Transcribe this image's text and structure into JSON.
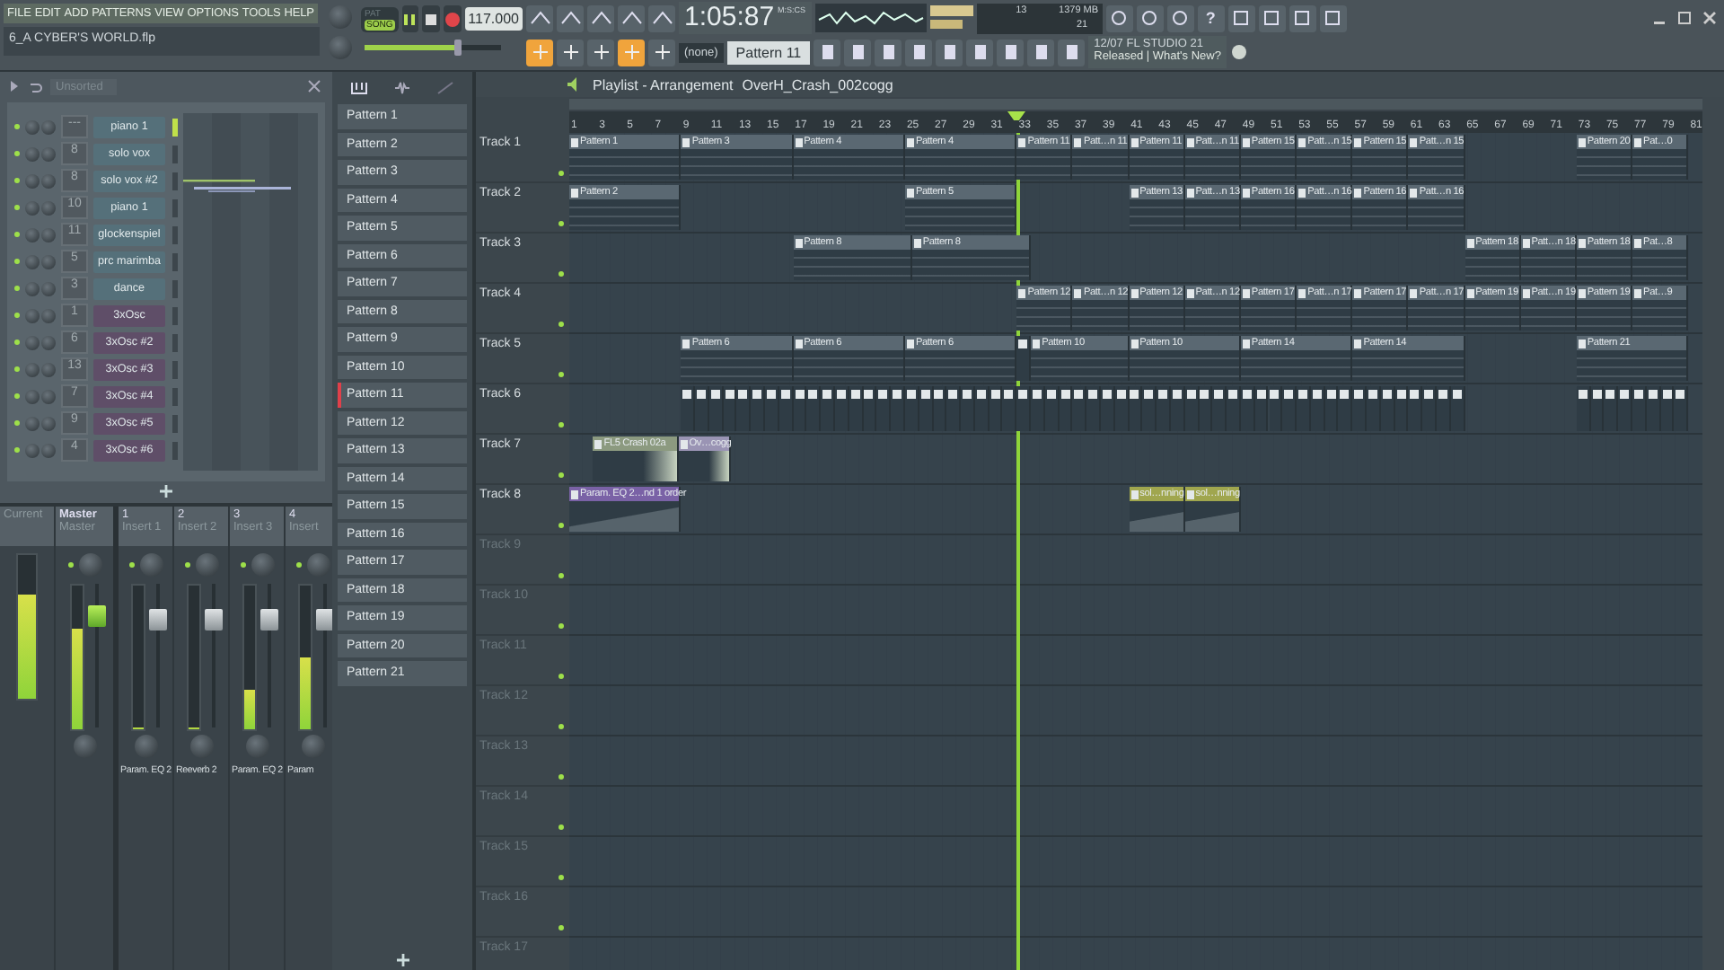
{
  "menu": [
    "FILE",
    "EDIT",
    "ADD",
    "PATTERNS",
    "VIEW",
    "OPTIONS",
    "TOOLS",
    "HELP"
  ],
  "project_file": "6_A CYBER'S WORLD.flp",
  "transport": {
    "modes": [
      {
        "label": "PAT",
        "selected": false
      },
      {
        "label": "SONG",
        "selected": true
      }
    ],
    "tempo": "117.000",
    "time": "1:05:87",
    "time_unit": "M:S:CS"
  },
  "master_pitch": {
    "level": 0.68
  },
  "toolbar_toggles": [
    {
      "on": true
    },
    {
      "on": false
    },
    {
      "on": false
    },
    {
      "on": true
    },
    {
      "on": false
    }
  ],
  "snap": "(none)",
  "current_pattern": "Pattern 11",
  "resources": {
    "cpu": "13",
    "memory": "1379 MB",
    "polyphony": "21"
  },
  "help_label": "?",
  "news": {
    "date": "12/07",
    "title": "FL STUDIO 21",
    "link": "Released | What's New?"
  },
  "channel_rack": {
    "filter": "Unsorted",
    "channels": [
      {
        "name": "piano 1",
        "mixer": "---",
        "kind": "instrument",
        "selected": true
      },
      {
        "name": "solo vox",
        "mixer": "8",
        "kind": "instrument",
        "selected": false
      },
      {
        "name": "solo vox #2",
        "mixer": "8",
        "kind": "instrument",
        "selected": false
      },
      {
        "name": "piano 1",
        "mixer": "10",
        "kind": "instrument",
        "selected": false
      },
      {
        "name": "glockenspiel",
        "mixer": "11",
        "kind": "instrument",
        "selected": false
      },
      {
        "name": "prc marimba",
        "mixer": "5",
        "kind": "instrument",
        "selected": false
      },
      {
        "name": "dance",
        "mixer": "3",
        "kind": "instrument",
        "selected": false
      },
      {
        "name": "3xOsc",
        "mixer": "1",
        "kind": "synth",
        "selected": false
      },
      {
        "name": "3xOsc #2",
        "mixer": "6",
        "kind": "synth",
        "selected": false
      },
      {
        "name": "3xOsc #3",
        "mixer": "13",
        "kind": "synth",
        "selected": false
      },
      {
        "name": "3xOsc #4",
        "mixer": "7",
        "kind": "synth",
        "selected": false
      },
      {
        "name": "3xOsc #5",
        "mixer": "9",
        "kind": "synth",
        "selected": false
      },
      {
        "name": "3xOsc #6",
        "mixer": "4",
        "kind": "synth",
        "selected": false
      }
    ]
  },
  "mixer": {
    "strips": [
      {
        "kind": "current",
        "name": "Current",
        "meter": {
          "level": 0.72
        }
      },
      {
        "kind": "master",
        "number": "Master",
        "name": "Master",
        "meter": {
          "level": 0.7
        },
        "fader": {
          "level": 0.78
        }
      },
      {
        "kind": "insert",
        "number": "1",
        "name": "Insert 1",
        "meter": {
          "level": 0
        },
        "fader": {
          "level": 0.75
        },
        "plugin": "Param. EQ 2"
      },
      {
        "kind": "insert",
        "number": "2",
        "name": "Insert 2",
        "meter": {
          "level": 0
        },
        "fader": {
          "level": 0.75
        },
        "plugin": "Reeverb 2"
      },
      {
        "kind": "insert",
        "number": "3",
        "name": "Insert 3",
        "meter": {
          "level": 0.28
        },
        "fader": {
          "level": 0.75
        },
        "plugin": "Param. EQ 2"
      },
      {
        "kind": "insert",
        "number": "4",
        "name": "Insert",
        "meter": {
          "level": 0.5
        },
        "fader": {
          "level": 0.75
        },
        "plugin": "Param"
      }
    ]
  },
  "patterns": [
    {
      "name": "Pattern 1",
      "selected": false
    },
    {
      "name": "Pattern 2",
      "selected": false
    },
    {
      "name": "Pattern 3",
      "selected": false
    },
    {
      "name": "Pattern 4",
      "selected": false
    },
    {
      "name": "Pattern 5",
      "selected": false
    },
    {
      "name": "Pattern 6",
      "selected": false
    },
    {
      "name": "Pattern 7",
      "selected": false
    },
    {
      "name": "Pattern 8",
      "selected": false
    },
    {
      "name": "Pattern 9",
      "selected": false
    },
    {
      "name": "Pattern 10",
      "selected": false
    },
    {
      "name": "Pattern 11",
      "selected": true
    },
    {
      "name": "Pattern 12",
      "selected": false
    },
    {
      "name": "Pattern 13",
      "selected": false
    },
    {
      "name": "Pattern 14",
      "selected": false
    },
    {
      "name": "Pattern 15",
      "selected": false
    },
    {
      "name": "Pattern 16",
      "selected": false
    },
    {
      "name": "Pattern 17",
      "selected": false
    },
    {
      "name": "Pattern 18",
      "selected": false
    },
    {
      "name": "Pattern 19",
      "selected": false
    },
    {
      "name": "Pattern 20",
      "selected": false
    },
    {
      "name": "Pattern 21",
      "selected": false
    }
  ],
  "playlist": {
    "title": "Playlist - Arrangement",
    "breadcrumb": "OverH_Crash_002cogg",
    "ruler": [
      "1",
      "3",
      "5",
      "7",
      "9",
      "11",
      "13",
      "15",
      "17",
      "19",
      "21",
      "23",
      "25",
      "27",
      "29",
      "31",
      "33",
      "35",
      "37",
      "39",
      "41",
      "43",
      "45",
      "47",
      "49",
      "51",
      "53",
      "55",
      "57",
      "59",
      "61",
      "63",
      "65",
      "67",
      "69",
      "71",
      "73",
      "75",
      "77",
      "79",
      "81"
    ],
    "playhead": {
      "level": 0.395
    },
    "tracks": [
      {
        "name": "Track 1",
        "clips": [
          {
            "kind": "pattern",
            "label": "Pattern 1"
          },
          {
            "kind": "pattern",
            "label": "Pattern 3"
          },
          {
            "kind": "pattern",
            "label": "Pattern 4"
          },
          {
            "kind": "pattern",
            "label": "Pattern 4"
          },
          {
            "kind": "pattern",
            "label": "Pattern 11"
          },
          {
            "kind": "pattern",
            "label": "Patt…n 11"
          },
          {
            "kind": "pattern",
            "label": "Pattern 11"
          },
          {
            "kind": "pattern",
            "label": "Patt…n 11"
          },
          {
            "kind": "pattern",
            "label": "Pattern 15"
          },
          {
            "kind": "pattern",
            "label": "Patt…n 15"
          },
          {
            "kind": "pattern",
            "label": "Pattern 15"
          },
          {
            "kind": "pattern",
            "label": "Patt…n 15"
          },
          {
            "kind": "pattern",
            "label": "Pattern 20"
          },
          {
            "kind": "pattern",
            "label": "Pat…0"
          }
        ]
      },
      {
        "name": "Track 2",
        "clips": [
          {
            "kind": "pattern",
            "label": "Pattern 2"
          },
          {
            "kind": "pattern",
            "label": "Pattern 5"
          },
          {
            "kind": "pattern",
            "label": "Pattern 13"
          },
          {
            "kind": "pattern",
            "label": "Patt…n 13"
          },
          {
            "kind": "pattern",
            "label": "Pattern 16"
          },
          {
            "kind": "pattern",
            "label": "Patt…n 16"
          },
          {
            "kind": "pattern",
            "label": "Pattern 16"
          },
          {
            "kind": "pattern",
            "label": "Patt…n 16"
          }
        ]
      },
      {
        "name": "Track 3",
        "clips": [
          {
            "kind": "pattern",
            "label": "Pattern 8"
          },
          {
            "kind": "pattern",
            "label": "Pattern 8"
          },
          {
            "kind": "pattern",
            "label": "Pattern 18"
          },
          {
            "kind": "pattern",
            "label": "Patt…n 18"
          },
          {
            "kind": "pattern",
            "label": "Pattern 18"
          },
          {
            "kind": "pattern",
            "label": "Pat…8"
          }
        ]
      },
      {
        "name": "Track 4",
        "clips": [
          {
            "kind": "pattern",
            "label": "Pattern 12"
          },
          {
            "kind": "pattern",
            "label": "Patt…n 12"
          },
          {
            "kind": "pattern",
            "label": "Pattern 12"
          },
          {
            "kind": "pattern",
            "label": "Patt…n 12"
          },
          {
            "kind": "pattern",
            "label": "Pattern 17"
          },
          {
            "kind": "pattern",
            "label": "Patt…n 17"
          },
          {
            "kind": "pattern",
            "label": "Pattern 17"
          },
          {
            "kind": "pattern",
            "label": "Patt…n 17"
          },
          {
            "kind": "pattern",
            "label": "Pattern 19"
          },
          {
            "kind": "pattern",
            "label": "Patt…n 19"
          },
          {
            "kind": "pattern",
            "label": "Pattern 19"
          },
          {
            "kind": "pattern",
            "label": "Pat…9"
          }
        ]
      },
      {
        "name": "Track 5",
        "clips": [
          {
            "kind": "pattern",
            "label": "Pattern 6"
          },
          {
            "kind": "pattern",
            "label": "Pattern 6"
          },
          {
            "kind": "pattern",
            "label": "Pattern 6"
          },
          {
            "kind": "block"
          },
          {
            "kind": "pattern",
            "label": "Pattern 10"
          },
          {
            "kind": "pattern",
            "label": "Pattern 10"
          },
          {
            "kind": "pattern",
            "label": "Pattern 14"
          },
          {
            "kind": "pattern",
            "label": "Pattern 14"
          },
          {
            "kind": "pattern",
            "label": "Pattern 21"
          }
        ]
      },
      {
        "name": "Track 6",
        "clips": [
          {
            "kind": "block_run"
          },
          {
            "kind": "block_run"
          }
        ]
      },
      {
        "name": "Track 7",
        "clips": [
          {
            "kind": "audio",
            "label": "FL5 Crash 02a",
            "color": "#8c9a80"
          },
          {
            "kind": "audio",
            "label": "Ov…cogg",
            "color": "#9a94b4"
          }
        ]
      },
      {
        "name": "Track 8",
        "clips": [
          {
            "kind": "automation",
            "label": "Param. EQ 2…nd 1 order",
            "color": "#7a62a6"
          },
          {
            "kind": "automation",
            "label": "sol…nning",
            "color": "#a0a64e"
          },
          {
            "kind": "automation",
            "label": "sol…nning",
            "color": "#a0a64e"
          }
        ]
      },
      {
        "name": "Track 9"
      },
      {
        "name": "Track 10"
      },
      {
        "name": "Track 11"
      },
      {
        "name": "Track 12"
      },
      {
        "name": "Track 13"
      },
      {
        "name": "Track 14"
      },
      {
        "name": "Track 15"
      },
      {
        "name": "Track 16"
      },
      {
        "name": "Track 17"
      }
    ]
  }
}
